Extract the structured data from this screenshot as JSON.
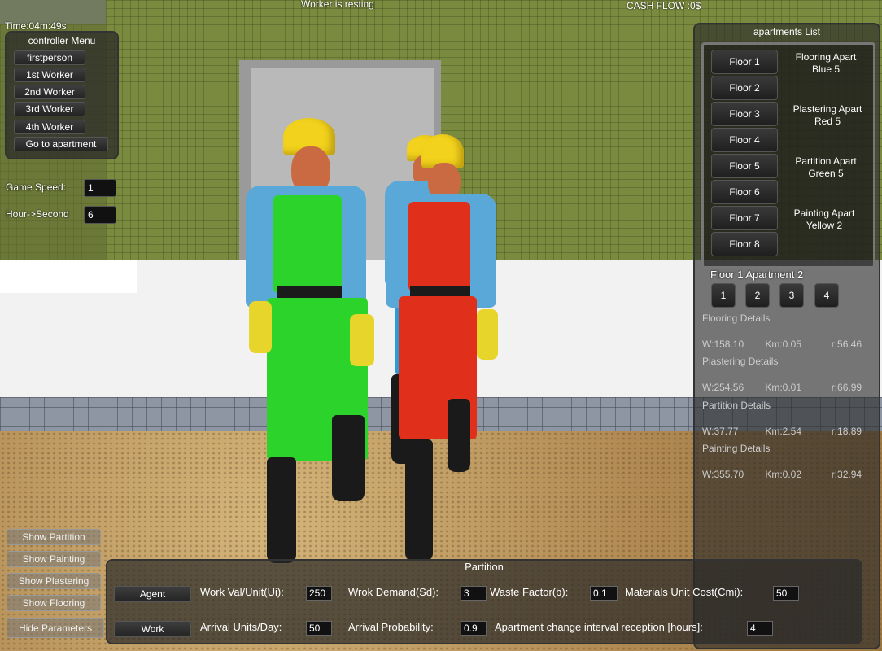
{
  "hud": {
    "timer": "Time:04m:49s",
    "status": "Worker is resting",
    "cash_flow": "CASH FLOW :0$"
  },
  "controller_menu": {
    "title": "controller Menu",
    "buttons": [
      "firstperson",
      "1st Worker",
      "2nd Worker",
      "3rd Worker",
      "4th Worker",
      "Go to apartment"
    ]
  },
  "settings": {
    "game_speed_label": "Game Speed:",
    "game_speed_value": "1",
    "hour_label": "Hour->Second",
    "hour_value": "6"
  },
  "apartments_list": {
    "title": "apartments List",
    "floors": [
      "Floor 1",
      "Floor 2",
      "Floor 3",
      "Floor 4",
      "Floor 5",
      "Floor 6",
      "Floor 7",
      "Floor 8"
    ],
    "info": [
      {
        "line1": "Flooring Apart",
        "line2": "Blue 5"
      },
      {
        "line1": "Plastering Apart",
        "line2": "Red  5"
      },
      {
        "line1": "Partition Apart",
        "line2": "Green   5"
      },
      {
        "line1": "Painting Apart",
        "line2": "Yellow   2"
      }
    ],
    "selected": "Floor 1 Apartment 2",
    "apartment_buttons": [
      "1",
      "2",
      "3",
      "4"
    ],
    "details": [
      {
        "title": "Flooring Details",
        "w": "W:158.10",
        "km": "Km:0.05",
        "r": "r:56.46"
      },
      {
        "title": "Plastering Details",
        "w": "W:254.56",
        "km": "Km:0.01",
        "r": "r:66.99"
      },
      {
        "title": "Partition Details",
        "w": "W:37.77",
        "km": "Km:2.54",
        "r": "r:18.89"
      },
      {
        "title": "Painting Details",
        "w": "W:355.70",
        "km": "Km:0.02",
        "r": "r:32.94"
      }
    ]
  },
  "show_buttons": [
    "Show Partition",
    "Show Painting",
    "Show Plastering",
    "Show Flooring",
    "Hide Parameters"
  ],
  "parameters": {
    "title": "Partition",
    "agent_button": "Agent",
    "work_button": "Work",
    "work_val_label": "Work Val/Unit(Ui):",
    "work_val_value": "250",
    "demand_label": "Wrok Demand(Sd):",
    "demand_value": "3",
    "waste_label": "Waste Factor(b):",
    "waste_value": "0.1",
    "material_label": "Materials Unit Cost(Cmi):",
    "material_value": "50",
    "arrival_units_label": "Arrival Units/Day:",
    "arrival_units_value": "50",
    "arrival_prob_label": "Arrival Probability:",
    "arrival_prob_value": "0.9",
    "interval_label": "Apartment change interval reception [hours]:",
    "interval_value": "4"
  },
  "colors": {
    "worker_green": "#2bd32b",
    "worker_red": "#e0301c",
    "worker_blue": "#2a9ad8",
    "shirt": "#5aa8d8",
    "helmet": "#f2d21c"
  }
}
